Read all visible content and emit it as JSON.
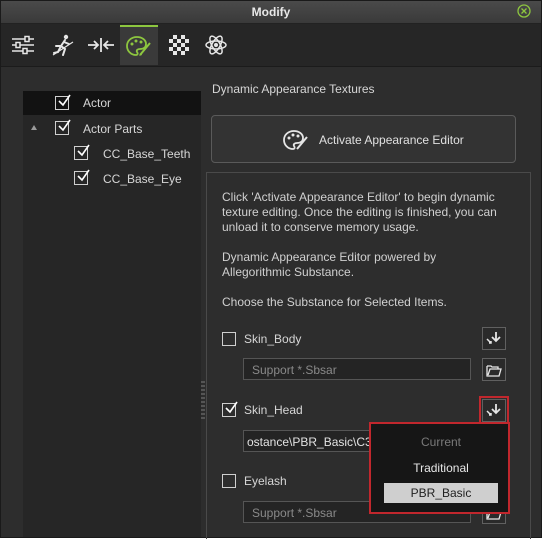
{
  "window": {
    "title": "Modify"
  },
  "tabs": [
    {
      "name": "sliders-tab",
      "icon": "sliders-icon"
    },
    {
      "name": "motion-tab",
      "icon": "running-figure-icon"
    },
    {
      "name": "reach-tab",
      "icon": "arrows-inward-icon"
    },
    {
      "name": "appearance-tab",
      "icon": "palette-icon",
      "active": true
    },
    {
      "name": "material-tab",
      "icon": "checkerboard-icon"
    },
    {
      "name": "physics-tab",
      "icon": "atom-icon"
    }
  ],
  "tree": {
    "items": [
      {
        "label": "Actor",
        "checked": true,
        "selected": true
      },
      {
        "label": "Actor Parts",
        "checked": true,
        "expanded": true
      },
      {
        "label": "CC_Base_Teeth",
        "checked": true
      },
      {
        "label": "CC_Base_Eye",
        "checked": true
      }
    ]
  },
  "main": {
    "section_title": "Dynamic Appearance Textures",
    "activate_button": "Activate Appearance Editor",
    "desc1_line1": "Click 'Activate Appearance Editor' to begin dynamic",
    "desc1_line2": "texture editing. Once the editing is finished, you can",
    "desc1_line3": "unload it to conserve memory usage.",
    "desc2_line1": "Dynamic Appearance Editor powered by",
    "desc2_line2": "Allegorithmic Substance.",
    "desc3": "Choose the Substance for Selected Items.",
    "items": [
      {
        "label": "Skin_Body",
        "checked": false,
        "path": "",
        "placeholder": "Support *.Sbsar"
      },
      {
        "label": "Skin_Head",
        "checked": true,
        "path": "ostance\\PBR_Basic\\C3",
        "placeholder": ""
      },
      {
        "label": "Eyelash",
        "checked": false,
        "path": "",
        "placeholder": "Support *.Sbsar"
      }
    ]
  },
  "dropdown": {
    "options": [
      {
        "label": "Current",
        "state": "disabled"
      },
      {
        "label": "Traditional",
        "state": "normal"
      },
      {
        "label": "PBR_Basic",
        "state": "highlighted"
      }
    ]
  },
  "colors": {
    "accent": "#8dc63f",
    "highlight_outline": "#c1272d",
    "background": "#2d2d2d"
  }
}
